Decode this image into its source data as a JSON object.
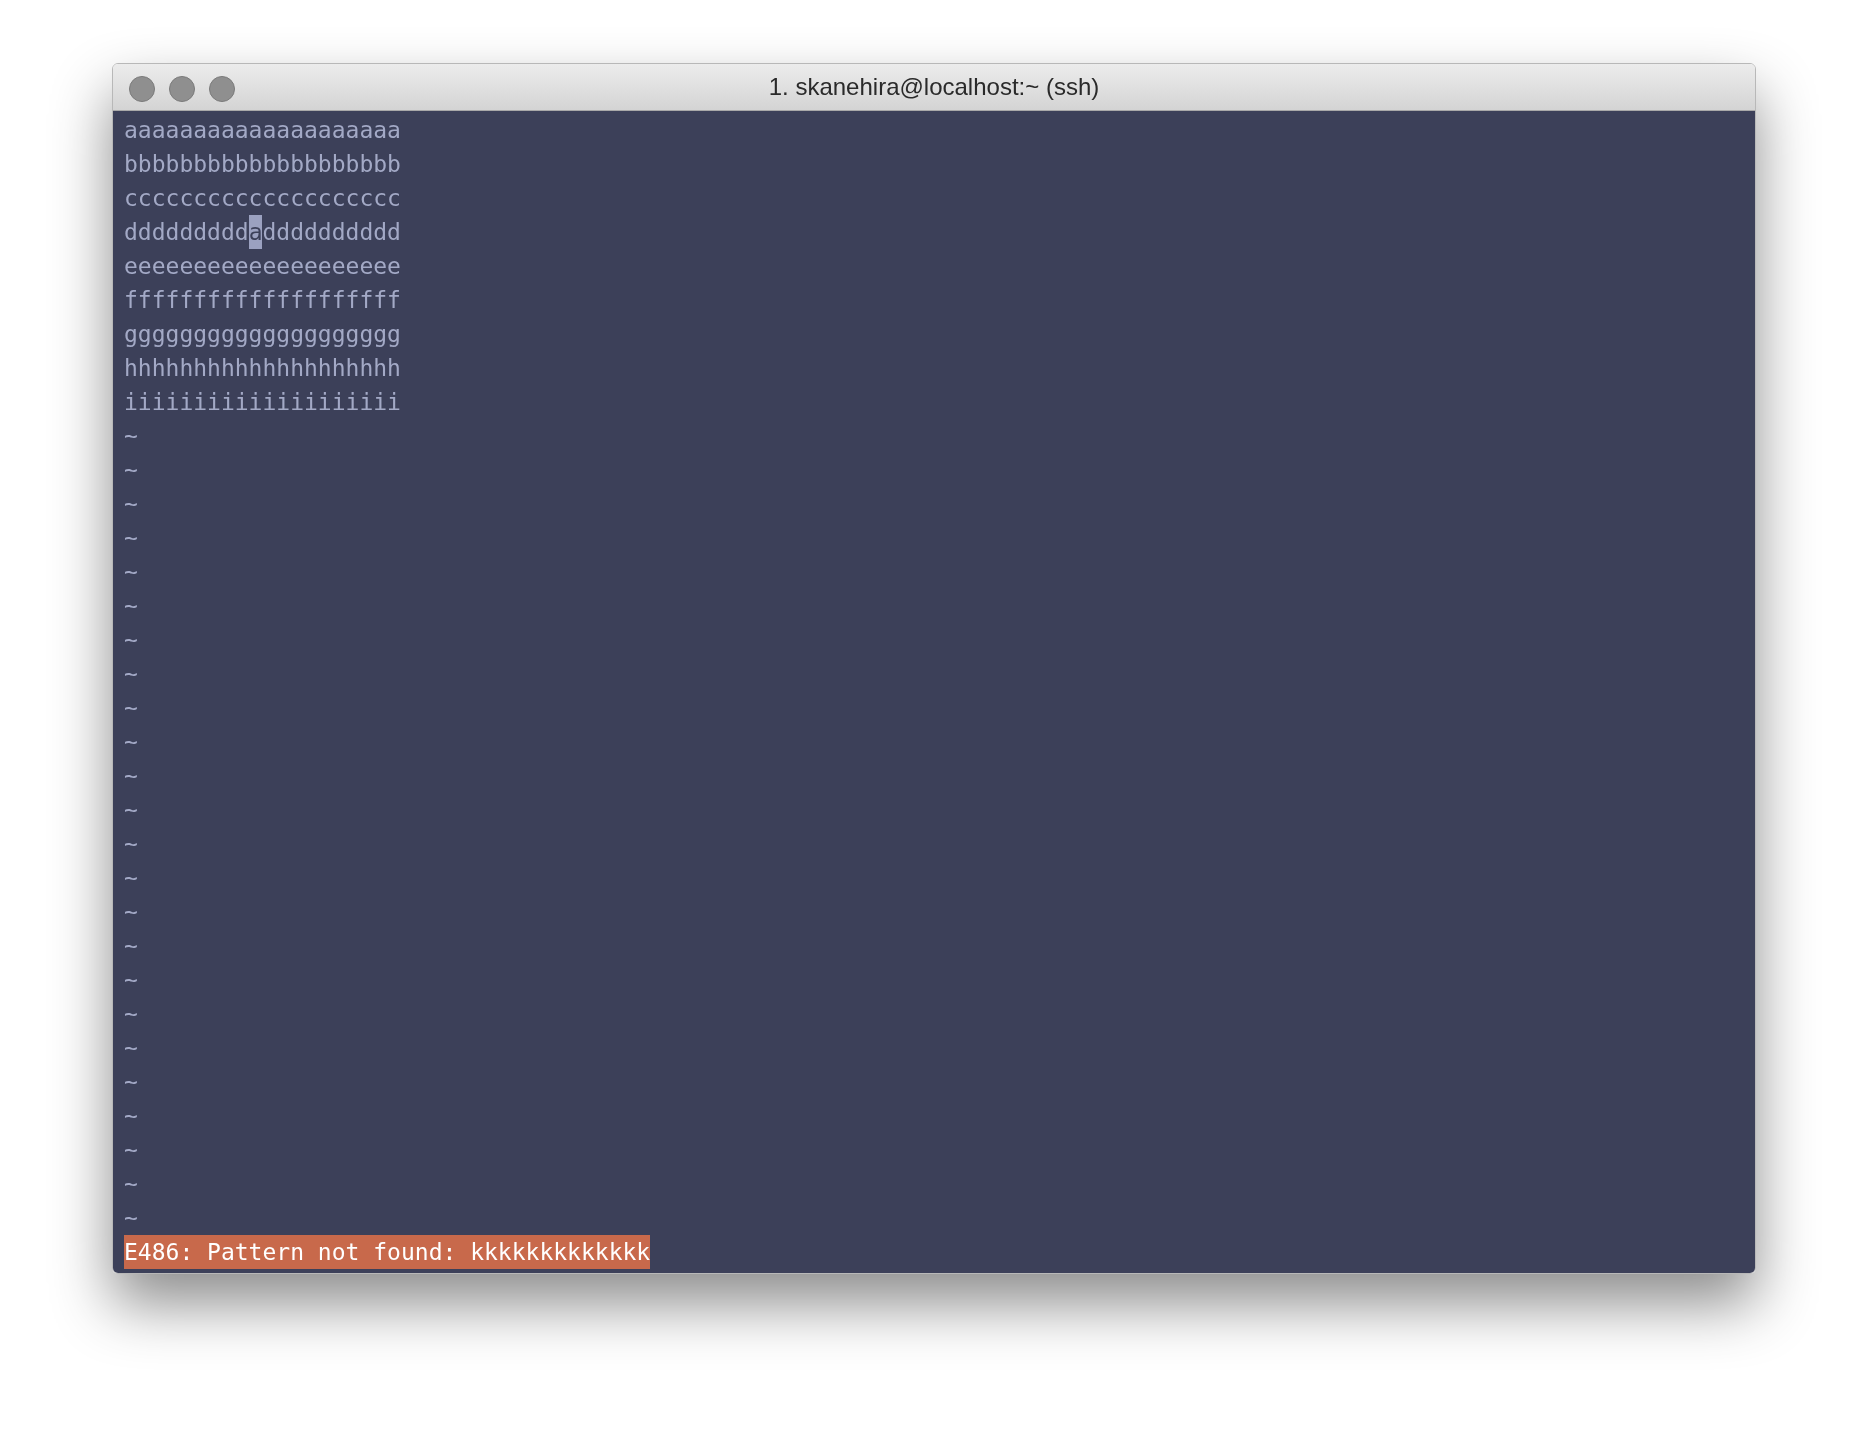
{
  "window": {
    "title": "1. skanehira@localhost:~ (ssh)"
  },
  "lines": [
    {
      "kind": "text",
      "text": "aaaaaaaaaaaaaaaaaaaa"
    },
    {
      "kind": "text",
      "text": "bbbbbbbbbbbbbbbbbbbb"
    },
    {
      "kind": "text",
      "text": "cccccccccccccccccccc"
    },
    {
      "kind": "cursor",
      "before": "ddddddddd",
      "cursor": "a",
      "after": "dddddddddd"
    },
    {
      "kind": "text",
      "text": "eeeeeeeeeeeeeeeeeeee"
    },
    {
      "kind": "text",
      "text": "ffffffffffffffffffff"
    },
    {
      "kind": "text",
      "text": "gggggggggggggggggggg"
    },
    {
      "kind": "text",
      "text": "hhhhhhhhhhhhhhhhhhhh"
    },
    {
      "kind": "text",
      "text": "iiiiiiiiiiiiiiiiiiii"
    }
  ],
  "empty_rows": [
    "~",
    "~",
    "~",
    "~",
    "~",
    "~",
    "~",
    "~",
    "~",
    "~",
    "~",
    "~",
    "~",
    "~",
    "~",
    "~",
    "~",
    "~",
    "~",
    "~",
    "~",
    "~",
    "~",
    "~"
  ],
  "status_line": {
    "kind": "error",
    "text": "E486: Pattern not found: kkkkkkkkkkkkk"
  }
}
